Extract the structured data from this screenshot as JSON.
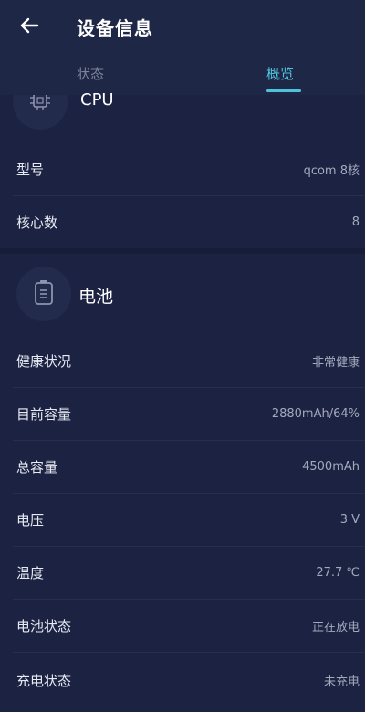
{
  "header": {
    "title": "设备信息",
    "tabs": [
      {
        "label": "状态",
        "active": false
      },
      {
        "label": "概览",
        "active": true
      }
    ]
  },
  "cpu": {
    "title": "CPU",
    "rows": [
      {
        "label": "型号",
        "value": "qcom 8核"
      },
      {
        "label": "核心数",
        "value": "8"
      }
    ]
  },
  "battery": {
    "title": "电池",
    "rows": [
      {
        "label": "健康状况",
        "value": "非常健康"
      },
      {
        "label": "目前容量",
        "value": "2880mAh/64%"
      },
      {
        "label": "总容量",
        "value": "4500mAh"
      },
      {
        "label": "电压",
        "value": "3 V"
      },
      {
        "label": "温度",
        "value": "27.7 ℃"
      },
      {
        "label": "电池状态",
        "value": "正在放电"
      },
      {
        "label": "充电状态",
        "value": "未充电"
      }
    ]
  },
  "colors": {
    "background": "#1c2342",
    "accent": "#4fc3d9",
    "muted_text": "#a4a9bd"
  }
}
